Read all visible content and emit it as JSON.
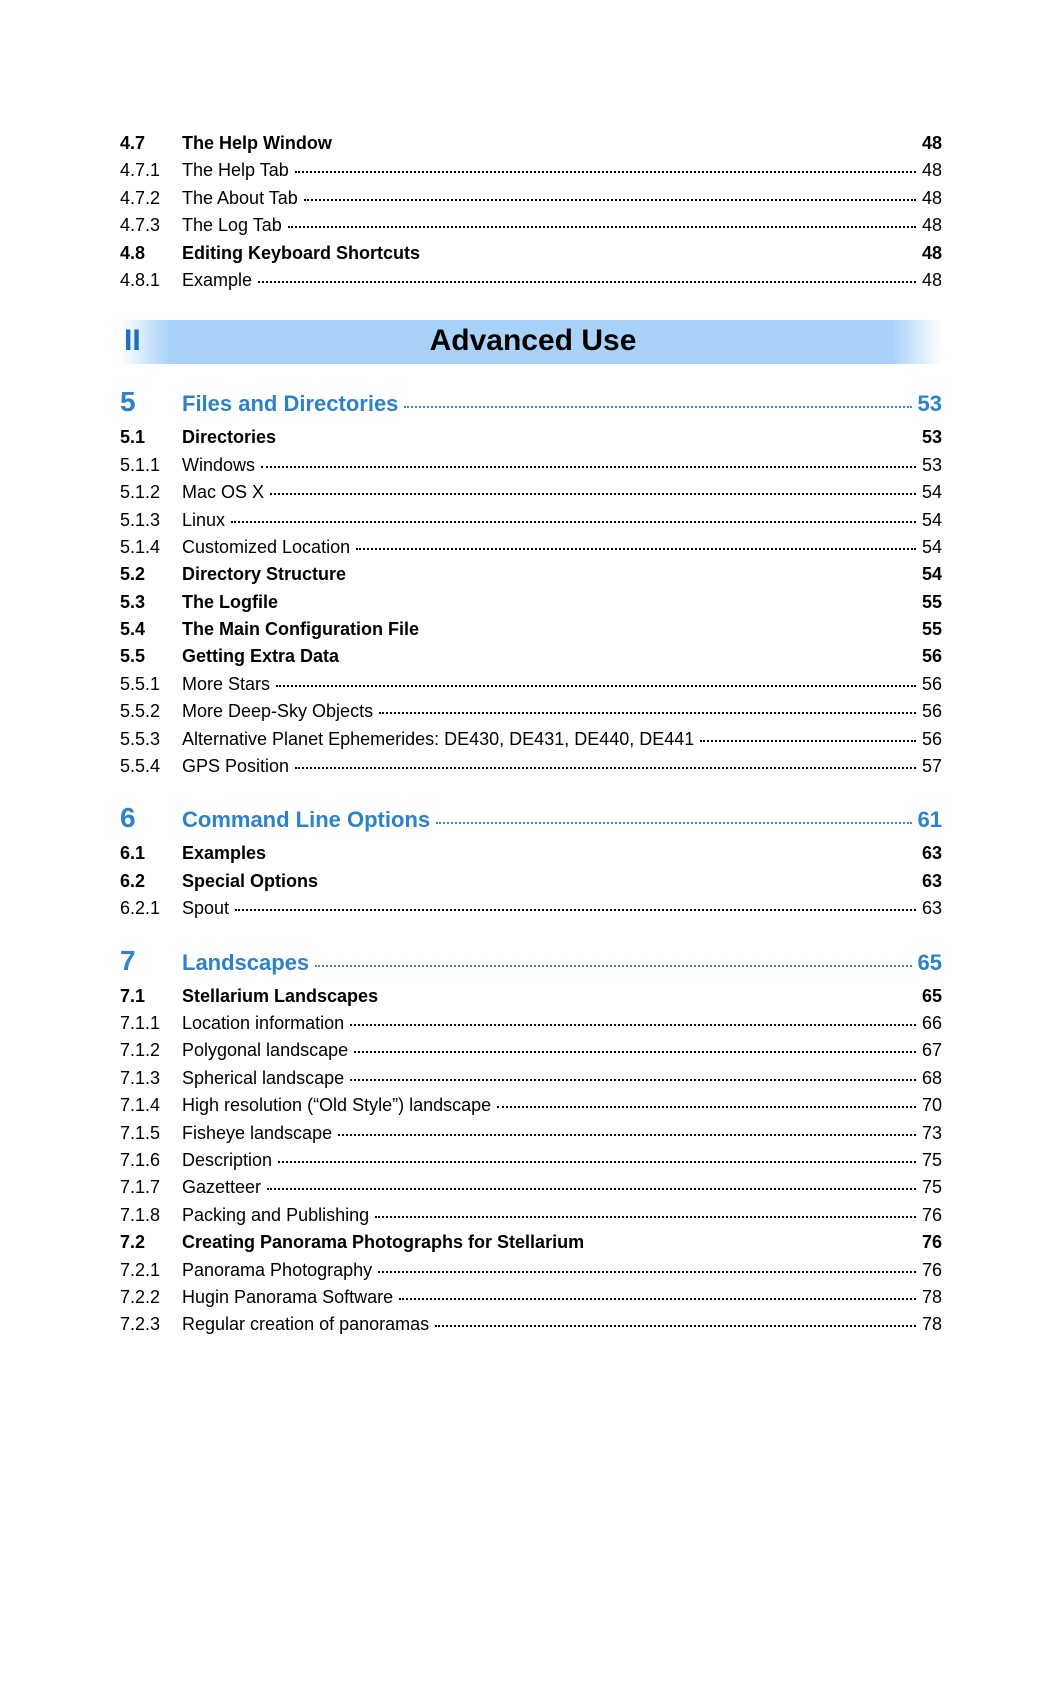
{
  "pre_part_lines": [
    {
      "num": "4.7",
      "title": "The Help Window",
      "page": "48",
      "bold": true
    },
    {
      "num": "4.7.1",
      "title": "The Help Tab",
      "page": "48",
      "bold": false
    },
    {
      "num": "4.7.2",
      "title": "The About Tab",
      "page": "48",
      "bold": false
    },
    {
      "num": "4.7.3",
      "title": "The Log Tab",
      "page": "48",
      "bold": false
    },
    {
      "num": "4.8",
      "title": "Editing Keyboard Shortcuts",
      "page": "48",
      "bold": true
    },
    {
      "num": "4.8.1",
      "title": "Example",
      "page": "48",
      "bold": false
    }
  ],
  "part": {
    "num": "II",
    "title": "Advanced Use"
  },
  "chapters": [
    {
      "num": "5",
      "title": "Files and Directories",
      "page": "53",
      "lines": [
        {
          "num": "5.1",
          "title": "Directories",
          "page": "53",
          "bold": true
        },
        {
          "num": "5.1.1",
          "title": "Windows",
          "page": "53",
          "bold": false
        },
        {
          "num": "5.1.2",
          "title": "Mac OS X",
          "page": "54",
          "bold": false
        },
        {
          "num": "5.1.3",
          "title": "Linux",
          "page": "54",
          "bold": false
        },
        {
          "num": "5.1.4",
          "title": "Customized Location",
          "page": "54",
          "bold": false
        },
        {
          "num": "5.2",
          "title": "Directory Structure",
          "page": "54",
          "bold": true
        },
        {
          "num": "5.3",
          "title": "The Logfile",
          "page": "55",
          "bold": true
        },
        {
          "num": "5.4",
          "title": "The Main Configuration File",
          "page": "55",
          "bold": true
        },
        {
          "num": "5.5",
          "title": "Getting Extra Data",
          "page": "56",
          "bold": true
        },
        {
          "num": "5.5.1",
          "title": "More Stars",
          "page": "56",
          "bold": false
        },
        {
          "num": "5.5.2",
          "title": "More Deep-Sky Objects",
          "page": "56",
          "bold": false
        },
        {
          "num": "5.5.3",
          "title": "Alternative Planet Ephemerides: DE430, DE431, DE440, DE441",
          "page": "56",
          "bold": false
        },
        {
          "num": "5.5.4",
          "title": "GPS Position",
          "page": "57",
          "bold": false
        }
      ]
    },
    {
      "num": "6",
      "title": "Command Line Options",
      "page": "61",
      "lines": [
        {
          "num": "6.1",
          "title": "Examples",
          "page": "63",
          "bold": true
        },
        {
          "num": "6.2",
          "title": "Special Options",
          "page": "63",
          "bold": true
        },
        {
          "num": "6.2.1",
          "title": "Spout",
          "page": "63",
          "bold": false
        }
      ]
    },
    {
      "num": "7",
      "title": "Landscapes",
      "page": "65",
      "lines": [
        {
          "num": "7.1",
          "title": "Stellarium Landscapes",
          "page": "65",
          "bold": true
        },
        {
          "num": "7.1.1",
          "title": "Location information",
          "page": "66",
          "bold": false
        },
        {
          "num": "7.1.2",
          "title": "Polygonal landscape",
          "page": "67",
          "bold": false
        },
        {
          "num": "7.1.3",
          "title": "Spherical landscape",
          "page": "68",
          "bold": false
        },
        {
          "num": "7.1.4",
          "title": "High resolution (“Old Style”) landscape",
          "page": "70",
          "bold": false
        },
        {
          "num": "7.1.5",
          "title": "Fisheye landscape",
          "page": "73",
          "bold": false
        },
        {
          "num": "7.1.6",
          "title": "Description",
          "page": "75",
          "bold": false
        },
        {
          "num": "7.1.7",
          "title": "Gazetteer",
          "page": "75",
          "bold": false
        },
        {
          "num": "7.1.8",
          "title": "Packing and Publishing",
          "page": "76",
          "bold": false
        },
        {
          "num": "7.2",
          "title": "Creating Panorama Photographs for Stellarium",
          "page": "76",
          "bold": true
        },
        {
          "num": "7.2.1",
          "title": "Panorama Photography",
          "page": "76",
          "bold": false
        },
        {
          "num": "7.2.2",
          "title": "Hugin Panorama Software",
          "page": "78",
          "bold": false
        },
        {
          "num": "7.2.3",
          "title": "Regular creation of panoramas",
          "page": "78",
          "bold": false
        }
      ]
    }
  ]
}
